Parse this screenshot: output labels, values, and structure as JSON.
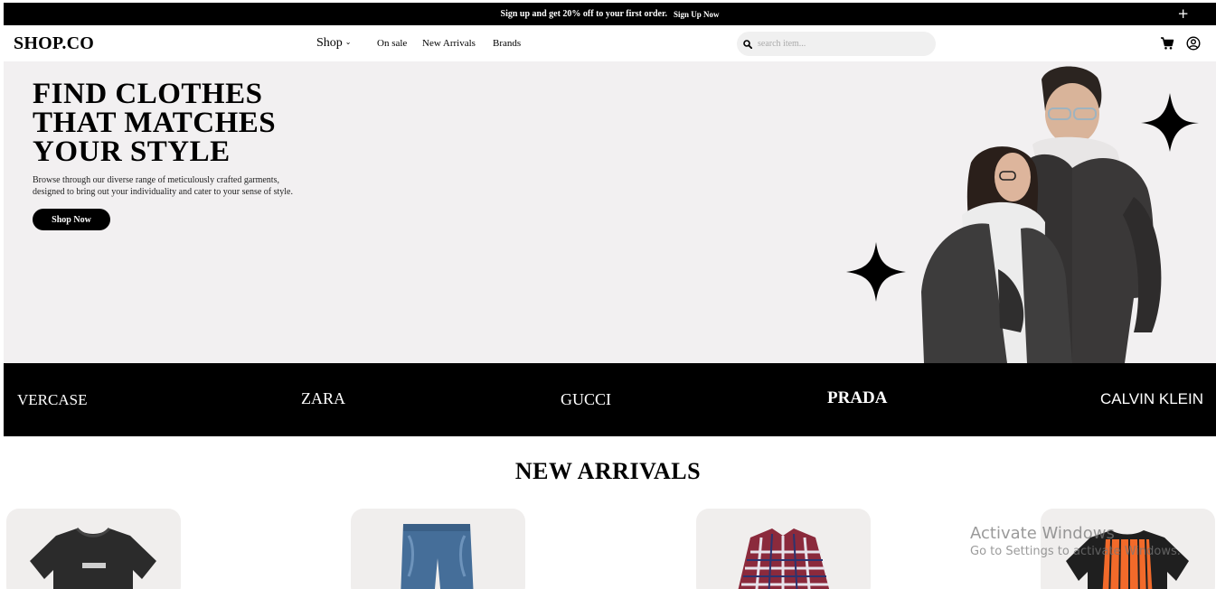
{
  "topbar": {
    "message": "Sign up and get 20% off to your first order.",
    "signup_label": "Sign Up Now",
    "close_label": "+"
  },
  "header": {
    "logo": "SHOP.CO",
    "nav": {
      "shop_label": "Shop",
      "on_sale_label": "On sale",
      "new_arrivals_label": "New Arrivals",
      "brands_label": "Brands"
    },
    "search": {
      "placeholder": "search item..."
    },
    "icons": [
      "cart-icon",
      "account-icon"
    ]
  },
  "hero": {
    "title_lines": [
      "FIND CLOTHES",
      "THAT MATCHES",
      "YOUR STYLE"
    ],
    "description_lines": [
      "Browse through our diverse range of meticulously crafted garments,",
      "designed to bring out your individuality and cater to your sense of style."
    ],
    "cta_label": "Shop Now"
  },
  "brands": [
    "VERCASE",
    "ZARA",
    "GUCCI",
    "PRADA",
    "CALVIN KLEIN"
  ],
  "new_arrivals": {
    "title": "NEW ARRIVALS",
    "products": [
      {
        "image": "black-tshirt"
      },
      {
        "image": "blue-jeans-shorts"
      },
      {
        "image": "checkered-shirt"
      },
      {
        "image": "orange-striped-tshirt"
      }
    ]
  },
  "watermark": {
    "line1": "Activate Windows",
    "line2": "Go to Settings to activate Windows."
  },
  "colors": {
    "black": "#000000",
    "hero_bg": "#f2f0f1",
    "card_bg": "#f0eeed",
    "search_bg": "#f0f0f0"
  }
}
